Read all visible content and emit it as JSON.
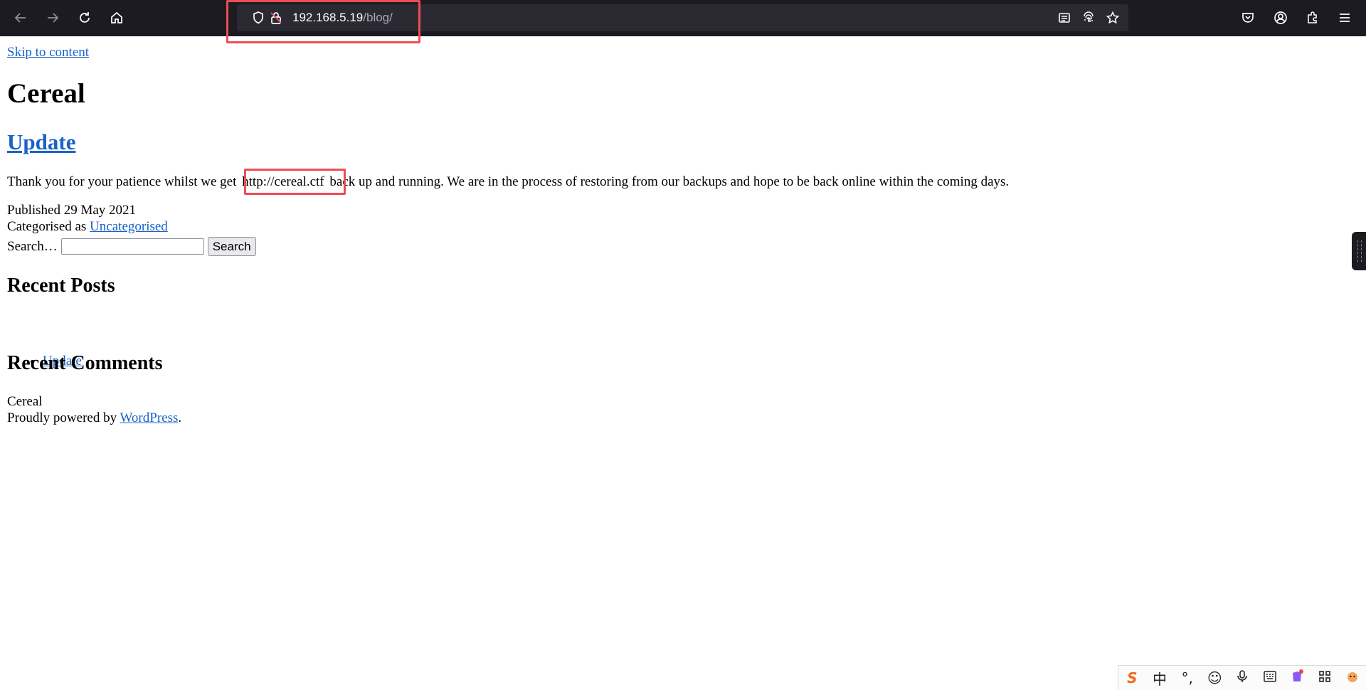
{
  "browser": {
    "url_host": "192.168.5.19",
    "url_path": "/blog/"
  },
  "page": {
    "skip_link": "Skip to content",
    "site_title": "Cereal",
    "post": {
      "title": "Update",
      "body_before": "Thank you for your patience whilst we get",
      "body_highlight": "http://cereal.ctf",
      "body_after": "back up and running. We are in the process of restoring from our backups and hope to be back online within the coming days.",
      "published_label": "Published",
      "published_date": "29 May 2021",
      "category_label": "Categorised as",
      "category": "Uncategorised"
    },
    "search": {
      "label": "Search…",
      "value": "",
      "button": "Search"
    },
    "recent_posts": {
      "heading": "Recent Posts",
      "items": [
        "Update"
      ]
    },
    "recent_comments": {
      "heading": "Recent Comments"
    },
    "footer": {
      "site_name": "Cereal",
      "powered_prefix": "Proudly powered by",
      "powered_link": "WordPress",
      "powered_suffix": "."
    }
  },
  "ime": {
    "logo": "S",
    "mode": "中",
    "punct": "°,"
  },
  "colors": {
    "toolbar_bg": "#1c1b22",
    "urlbar_bg": "#2b2a33",
    "link": "#1a62c7",
    "highlight_box": "#ef4c55"
  }
}
